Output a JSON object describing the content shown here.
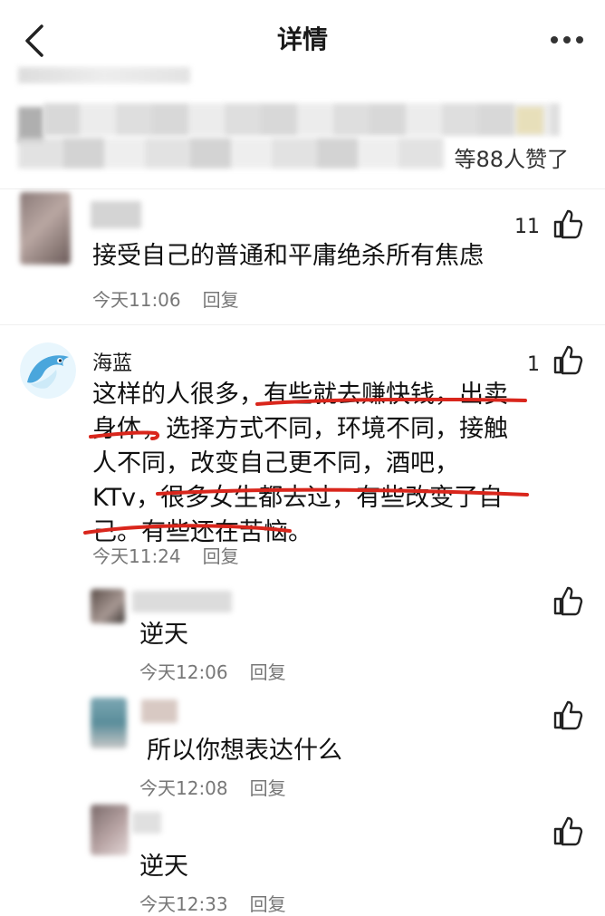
{
  "header": {
    "title": "详情"
  },
  "likes_summary": {
    "text": "等88人赞了"
  },
  "comments": [
    {
      "content": "接受自己的普通和平庸绝杀所有焦虑",
      "time": "今天11:06",
      "reply": "回复",
      "likes": "11"
    },
    {
      "username": "海蓝",
      "lines": [
        "这样的人很多，有些就去赚快钱，出卖",
        "身体，选择方式不同，环境不同，接触",
        "人不同，改变自己更不同，酒吧，",
        "KTv，很多女生都去过，有些改变了自",
        "己。有些还在苦恼。"
      ],
      "time": "今天11:24",
      "reply": "回复",
      "likes": "1"
    }
  ],
  "replies": [
    {
      "content": "逆天",
      "time": "今天12:06",
      "reply": "回复"
    },
    {
      "content": "所以你想表达什么",
      "time": "今天12:08",
      "reply": "回复"
    },
    {
      "content": "逆天",
      "time": "今天12:33",
      "reply": "回复"
    }
  ],
  "colors": {
    "underline": "#d9261c",
    "meta": "#777777"
  }
}
